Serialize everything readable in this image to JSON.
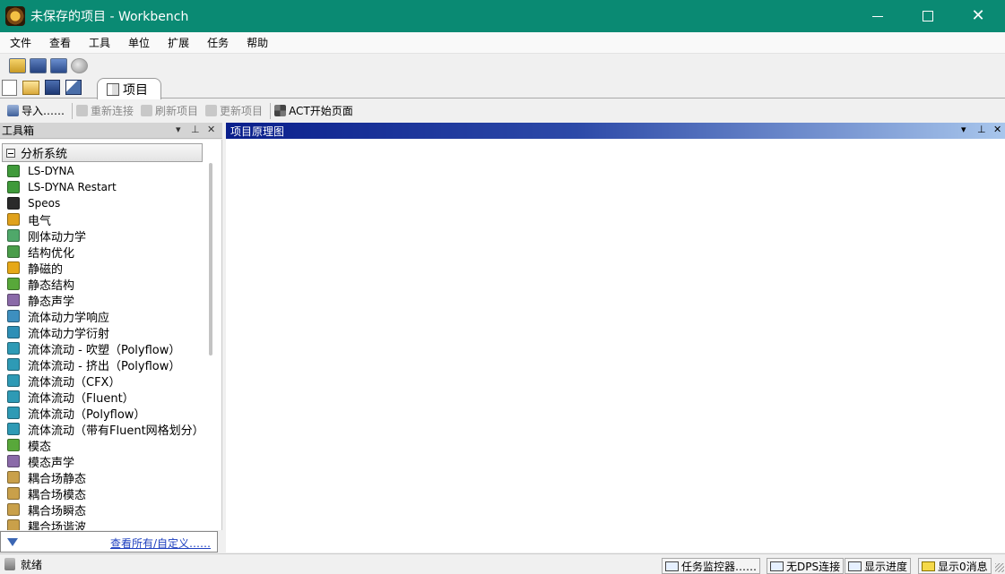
{
  "window": {
    "title": "未保存的项目 - Workbench",
    "app_icon": "workbench-logo-icon",
    "controls": [
      "minimize-icon",
      "maximize-icon",
      "close-icon"
    ]
  },
  "menu": [
    "文件",
    "查看",
    "工具",
    "单位",
    "扩展",
    "任务",
    "帮助"
  ],
  "toolbar_top": {
    "icons": [
      "open-project-icon",
      "save-icon",
      "save-as-icon",
      "web-icon"
    ]
  },
  "toolbar_file": {
    "icons": [
      "new-icon",
      "open-icon",
      "save-icon",
      "export-image-icon"
    ]
  },
  "tabs": [
    {
      "label": "项目",
      "icon": "project-tab-icon",
      "active": true
    }
  ],
  "toolbar_actions": {
    "import": "导入……",
    "reconnect": "重新连接",
    "refresh": "刷新项目",
    "update": "更新项目",
    "act_start": "ACT开始页面"
  },
  "toolbox": {
    "title": "工具箱",
    "group": "分析系统",
    "items": [
      {
        "label": "LS-DYNA",
        "color": "#3f9a3a"
      },
      {
        "label": "LS-DYNA Restart",
        "color": "#3f9a3a"
      },
      {
        "label": "Speos",
        "color": "#2a2a2a"
      },
      {
        "label": "电气",
        "color": "#e0a11b"
      },
      {
        "label": "刚体动力学",
        "color": "#4fa86a"
      },
      {
        "label": "结构优化",
        "color": "#4a9d4a"
      },
      {
        "label": "静磁的",
        "color": "#e6a817"
      },
      {
        "label": "静态结构",
        "color": "#58a83a"
      },
      {
        "label": "静态声学",
        "color": "#8a6aa8"
      },
      {
        "label": "流体动力学响应",
        "color": "#3d8fbf"
      },
      {
        "label": "流体动力学衍射",
        "color": "#2e8fb6"
      },
      {
        "label": "流体流动 - 吹塑（Polyflow）",
        "color": "#2e9ab5"
      },
      {
        "label": "流体流动 - 挤出（Polyflow）",
        "color": "#2e9ab5"
      },
      {
        "label": "流体流动（CFX）",
        "color": "#2e9ab5"
      },
      {
        "label": "流体流动（Fluent）",
        "color": "#2e9ab5"
      },
      {
        "label": "流体流动（Polyflow）",
        "color": "#2e9ab5"
      },
      {
        "label": "流体流动（带有Fluent网格划分）",
        "color": "#2e9ab5"
      },
      {
        "label": "模态",
        "color": "#58a83a"
      },
      {
        "label": "模态声学",
        "color": "#8a6aa8"
      },
      {
        "label": "耦合场静态",
        "color": "#c9a04a"
      },
      {
        "label": "耦合场模态",
        "color": "#c9a04a"
      },
      {
        "label": "耦合场瞬态",
        "color": "#c9a04a"
      },
      {
        "label": "耦合场谐波",
        "color": "#c9a04a"
      }
    ],
    "footer_link": "查看所有/自定义……"
  },
  "schematic": {
    "title": "项目原理图"
  },
  "status": {
    "text": "就绪",
    "job_monitor": "任务监控器……",
    "dps": "无DPS连接",
    "progress": "显示进度",
    "messages": "显示0消息"
  }
}
